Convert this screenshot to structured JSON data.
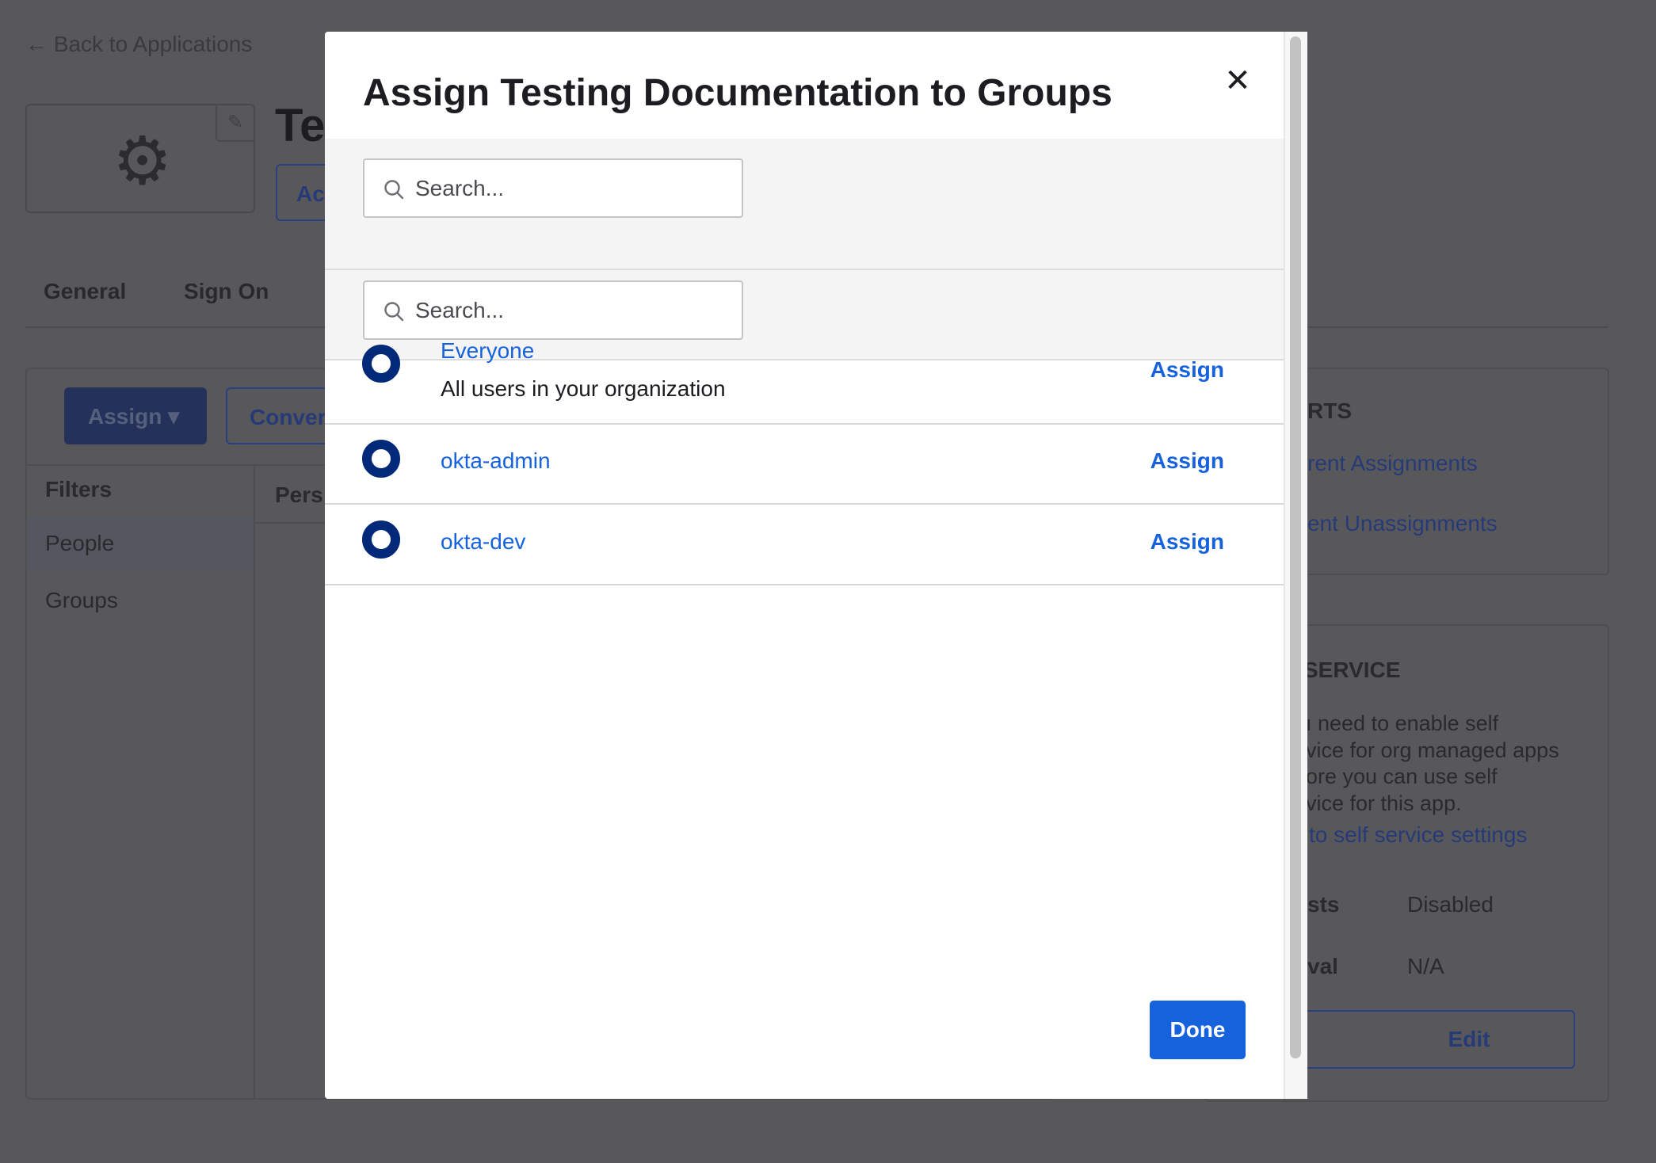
{
  "background": {
    "back_link": "← Back to Applications",
    "app_title_fragment": "Te",
    "active_button_fragment": "Ac",
    "tabs": [
      "General",
      "Sign On"
    ],
    "assign_dropdown": "Assign ▾",
    "convert_button_fragment": "Conver",
    "filters": {
      "header": "Filters",
      "items": [
        "People",
        "Groups"
      ]
    },
    "column_header_fragment": "Pers",
    "reports": {
      "heading_fragment": "RTS",
      "links": [
        "rent Assignments",
        "ent Unassignments"
      ]
    },
    "self_service": {
      "heading_fragment": "SERVICE",
      "paragraph_lines": [
        "ı need to enable self",
        "vice for org managed apps",
        "ore you can use self",
        "vice for this app."
      ],
      "settings_link_fragment": "to self service settings",
      "rows": [
        {
          "label": "sts",
          "value": "Disabled"
        },
        {
          "label": "val",
          "value": "N/A"
        }
      ],
      "edit_button": "Edit"
    }
  },
  "modal": {
    "title": "Assign Testing Documentation to Groups",
    "close_icon": "close-icon",
    "search_placeholders": [
      "Search...",
      "Search..."
    ],
    "groups": [
      {
        "name": "Everyone",
        "description": "All users in your organization",
        "action": "Assign"
      },
      {
        "name": "okta-admin",
        "action": "Assign"
      },
      {
        "name": "okta-dev",
        "action": "Assign"
      }
    ],
    "done_button": "Done"
  },
  "colors": {
    "accent": "#1662dd",
    "radio": "#00297a",
    "overlay": "#58585a"
  }
}
